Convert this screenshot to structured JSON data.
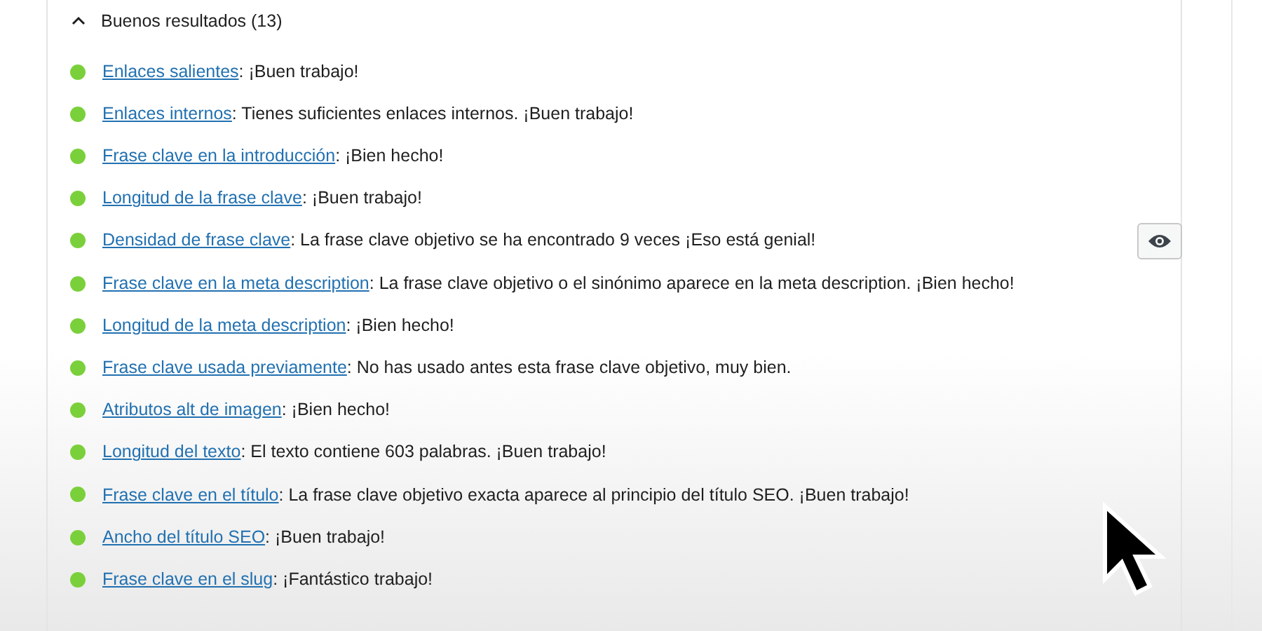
{
  "section": {
    "title": "Buenos resultados (13)",
    "expanded": true
  },
  "results": [
    {
      "link": "Enlaces salientes",
      "text": ": ¡Buen trabajo!",
      "eye_button": false
    },
    {
      "link": "Enlaces internos",
      "text": ": Tienes suficientes enlaces internos. ¡Buen trabajo!",
      "eye_button": false
    },
    {
      "link": "Frase clave en la introducción",
      "text": ": ¡Bien hecho!",
      "eye_button": false
    },
    {
      "link": "Longitud de la frase clave",
      "text": ": ¡Buen trabajo!",
      "eye_button": false
    },
    {
      "link": "Densidad de frase clave",
      "text": ": La frase clave objetivo se ha encontrado 9 veces ¡Eso está genial!",
      "eye_button": true
    },
    {
      "link": "Frase clave en la meta description",
      "text": ": La frase clave objetivo o el sinónimo aparece en la meta description. ¡Bien hecho!",
      "eye_button": false
    },
    {
      "link": "Longitud de la meta description",
      "text": ": ¡Bien hecho!",
      "eye_button": false
    },
    {
      "link": "Frase clave usada previamente",
      "text": ": No has usado antes esta frase clave objetivo, muy bien.",
      "eye_button": false
    },
    {
      "link": "Atributos alt de imagen",
      "text": ": ¡Bien hecho!",
      "eye_button": false
    },
    {
      "link": "Longitud del texto",
      "text": ": El texto contiene 603 palabras. ¡Buen trabajo!",
      "eye_button": false
    },
    {
      "link": "Frase clave en el título",
      "text": ": La frase clave objetivo exacta aparece al principio del título SEO. ¡Buen trabajo!",
      "eye_button": false
    },
    {
      "link": "Ancho del título SEO",
      "text": ": ¡Buen trabajo!",
      "eye_button": false
    },
    {
      "link": "Frase clave en el slug",
      "text": ": ¡Fantástico trabajo!",
      "eye_button": false
    }
  ]
}
